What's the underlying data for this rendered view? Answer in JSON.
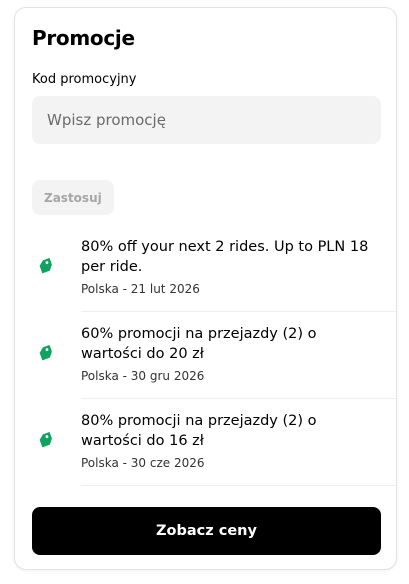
{
  "header": {
    "title": "Promocje"
  },
  "promo_code": {
    "label": "Kod promocyjny",
    "placeholder": "Wpisz promocję",
    "value": "",
    "apply_label": "Zastosuj"
  },
  "promotions": [
    {
      "description": "80% off your next 2 rides. Up to PLN 18 per ride.",
      "meta": "Polska - 21 lut 2026",
      "icon": "tag-icon"
    },
    {
      "description": "60% promocji na przejazdy (2) o wartości do 20 zł",
      "meta": "Polska - 30 gru 2026",
      "icon": "tag-icon"
    },
    {
      "description": "80% promocji na przejazdy (2) o wartości do 16 zł",
      "meta": "Polska - 30 cze 2026",
      "icon": "tag-icon"
    }
  ],
  "footer": {
    "cta_label": "Zobacz ceny"
  },
  "colors": {
    "accent_green": "#0fa35f",
    "cta_bg": "#000000",
    "input_bg": "#f3f3f3",
    "disabled_text": "#a6a6a6"
  }
}
